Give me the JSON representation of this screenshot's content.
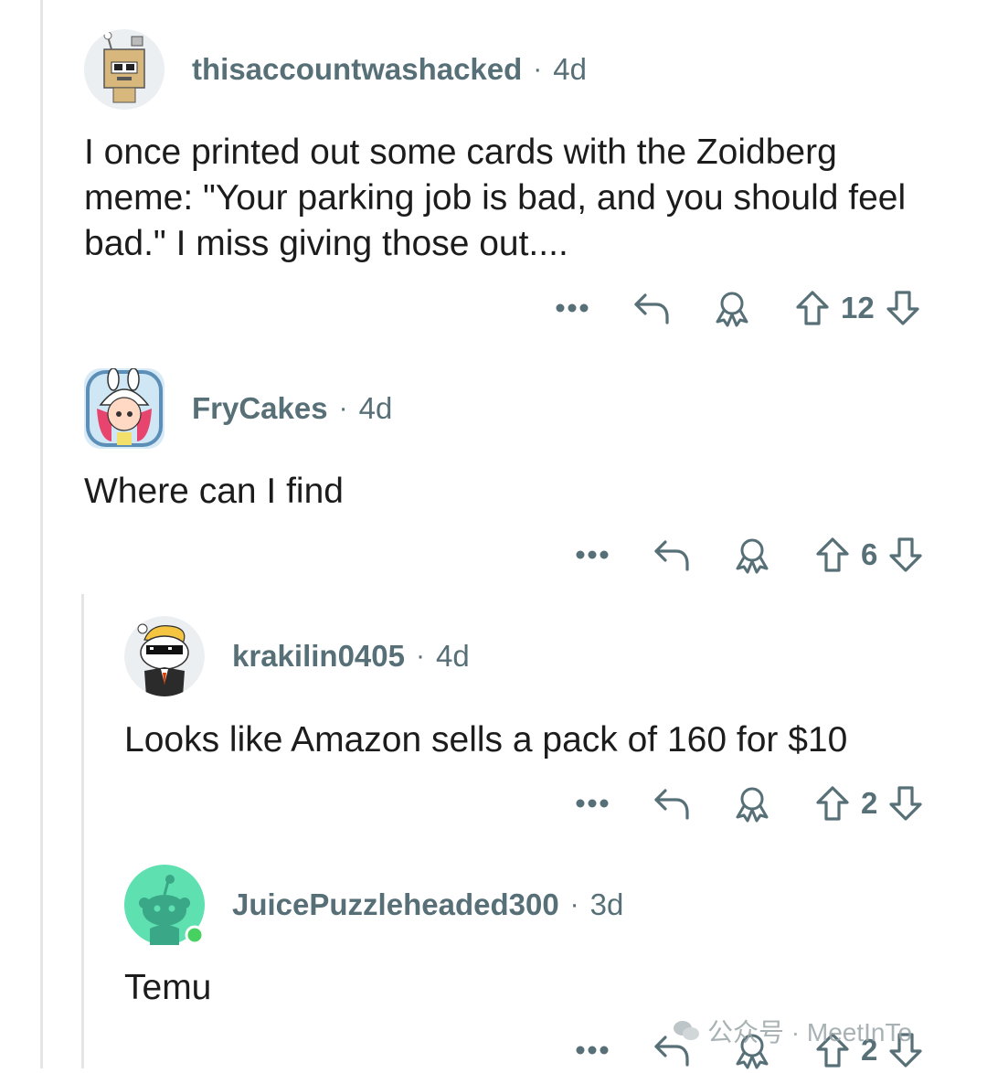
{
  "comments": [
    {
      "username": "thisaccountwashacked",
      "age": "4d",
      "body": "I once printed out some cards with the Zoidberg meme: \"Your parking job is bad, and you should feel bad.\" I miss giving those out....",
      "votes": "12",
      "avatar_icon": "robot-box-avatar-icon"
    },
    {
      "username": "FryCakes",
      "age": "4d",
      "body": "Where can I find",
      "votes": "6",
      "avatar_icon": "bunny-hat-avatar-icon"
    },
    {
      "username": "krakilin0405",
      "age": "4d",
      "body": "Looks like Amazon sells a pack of 160 for $10",
      "votes": "2",
      "avatar_icon": "sunglasses-snoo-avatar-icon"
    },
    {
      "username": "JuicePuzzleheaded300",
      "age": "3d",
      "body": "Temu",
      "votes": "2",
      "avatar_icon": "default-snoo-avatar-icon",
      "online": true
    }
  ],
  "separator": "·",
  "watermark": {
    "text": "公众号 · MeetInTo"
  },
  "colors": {
    "meta_text": "#576f76",
    "body_text": "#1c1c1c",
    "thread_line": "#e5e5e5",
    "online_dot": "#46d160"
  }
}
